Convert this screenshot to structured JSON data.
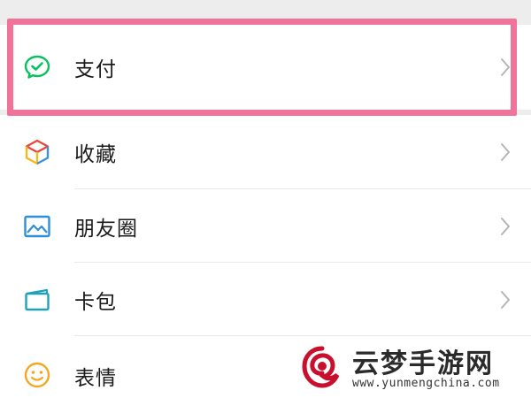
{
  "menu": {
    "items": [
      {
        "label": "支付",
        "icon": "wechat-pay-icon"
      },
      {
        "label": "收藏",
        "icon": "favorites-cube-icon"
      },
      {
        "label": "朋友圈",
        "icon": "moments-image-icon"
      },
      {
        "label": "卡包",
        "icon": "card-wallet-icon"
      },
      {
        "label": "表情",
        "icon": "emoji-smile-icon"
      }
    ]
  },
  "highlight": {
    "color": "#f07399"
  },
  "watermark": {
    "title": "云梦手游网",
    "url": "www.yunmengchina.com"
  },
  "colors": {
    "pay_green": "#07c160",
    "moments_blue": "#2f8fd8",
    "card_teal": "#1fa1b8",
    "emoji_orange": "#f5a623"
  }
}
